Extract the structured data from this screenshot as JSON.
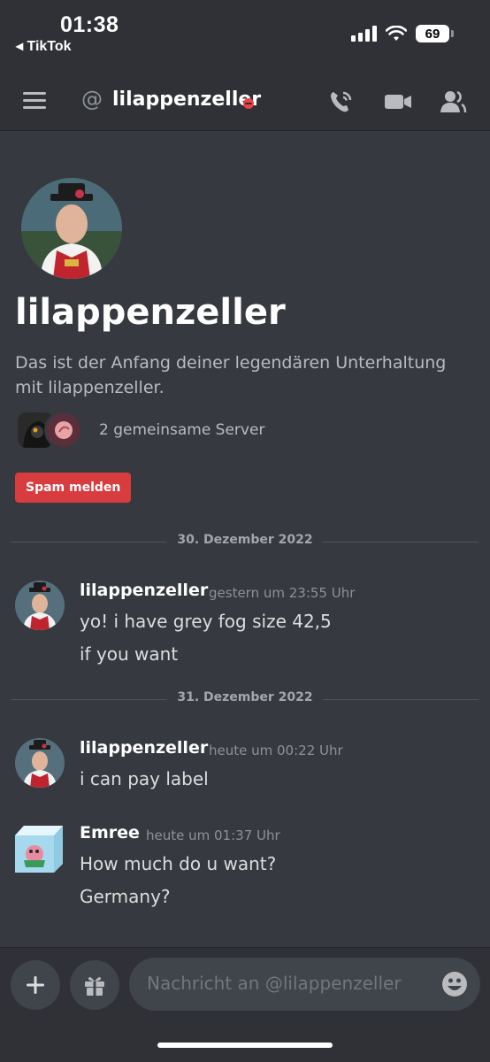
{
  "status_bar": {
    "time": "01:38",
    "back_label": "◂ TikTok",
    "battery": "69"
  },
  "header": {
    "username": "lilappenzeller",
    "status": "dnd",
    "icons": [
      "menu-icon",
      "at-icon",
      "call-icon",
      "video-icon",
      "members-icon"
    ]
  },
  "profile": {
    "name": "lilappenzeller",
    "intro": "Das ist der Anfang deiner legendären Unterhaltung mit lilappenzeller.",
    "mutual_servers": "2 gemeinsame Server",
    "spam_button": "Spam melden"
  },
  "dividers": [
    "30. Dezember 2022",
    "31. Dezember 2022"
  ],
  "messages": [
    {
      "author": "lilappenzeller",
      "timestamp": "gestern um 23:55 Uhr",
      "lines": [
        "yo! i have grey fog size 42,5",
        "if you want"
      ]
    },
    {
      "author": "lilappenzeller",
      "timestamp": "heute um 00:22 Uhr",
      "lines": [
        "i can pay label"
      ]
    },
    {
      "author": "Emree",
      "timestamp": "heute um 01:37 Uhr",
      "lines": [
        "How much do u want?",
        "Germany?"
      ]
    }
  ],
  "composer": {
    "placeholder": "Nachricht an @lilappenzeller"
  },
  "colors": {
    "background": "#36393f",
    "header": "#2f3136",
    "danger": "#d83c3e",
    "dnd": "#ed4245"
  }
}
